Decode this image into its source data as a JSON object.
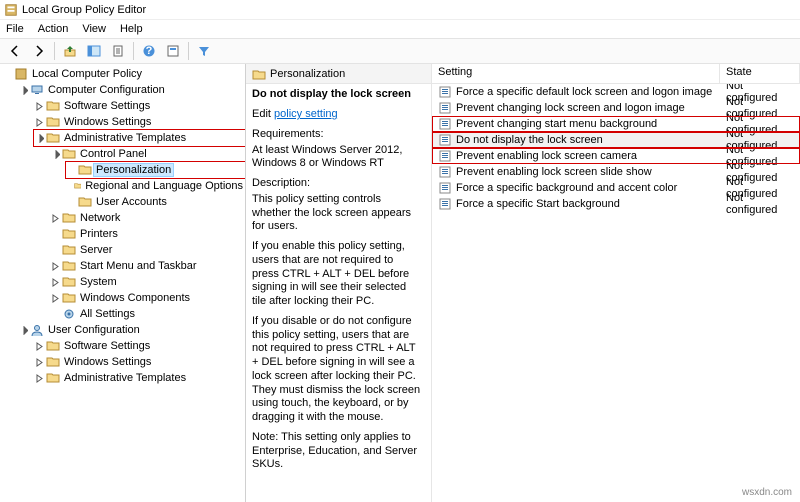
{
  "window": {
    "title": "Local Group Policy Editor"
  },
  "menu": {
    "file": "File",
    "action": "Action",
    "view": "View",
    "help": "Help"
  },
  "tree": {
    "root": "Local Computer Policy",
    "cc": "Computer Configuration",
    "ss": "Software Settings",
    "ws": "Windows Settings",
    "at": "Administrative Templates",
    "cp": "Control Panel",
    "pers": "Personalization",
    "rlo": "Regional and Language Options",
    "ua": "User Accounts",
    "net": "Network",
    "prn": "Printers",
    "srv": "Server",
    "smt": "Start Menu and Taskbar",
    "sys": "System",
    "wcomp": "Windows Components",
    "alls": "All Settings",
    "uc": "User Configuration",
    "uss": "Software Settings",
    "uws": "Windows Settings",
    "uat": "Administrative Templates"
  },
  "desc": {
    "crumb": "Personalization",
    "title": "Do not display the lock screen",
    "edit": "Edit",
    "policy_link": "policy setting",
    "req_label": "Requirements:",
    "req_text": "At least Windows Server 2012, Windows 8 or Windows RT",
    "desc_label": "Description:",
    "d1": "This policy setting controls whether the lock screen appears for users.",
    "d2": "If you enable this policy setting, users that are not required to press CTRL + ALT + DEL before signing in will see their selected tile after locking their PC.",
    "d3": "If you disable or do not configure this policy setting, users that are not required to press CTRL + ALT + DEL before signing in will see a lock screen after locking their PC. They must dismiss the lock screen using touch, the keyboard, or by dragging it with the mouse.",
    "d4": "Note: This setting only applies to Enterprise, Education, and Server SKUs."
  },
  "list": {
    "col_setting": "Setting",
    "col_state": "State",
    "items": [
      {
        "name": "Force a specific default lock screen and logon image",
        "state": "Not configured",
        "hl": false,
        "sel": false
      },
      {
        "name": "Prevent changing lock screen and logon image",
        "state": "Not configured",
        "hl": false,
        "sel": false
      },
      {
        "name": "Prevent changing start menu background",
        "state": "Not configured",
        "hl": true,
        "sel": false
      },
      {
        "name": "Do not display the lock screen",
        "state": "Not configured",
        "hl": true,
        "sel": true
      },
      {
        "name": "Prevent enabling lock screen camera",
        "state": "Not configured",
        "hl": true,
        "sel": false
      },
      {
        "name": "Prevent enabling lock screen slide show",
        "state": "Not configured",
        "hl": false,
        "sel": false
      },
      {
        "name": "Force a specific background and accent color",
        "state": "Not configured",
        "hl": false,
        "sel": false
      },
      {
        "name": "Force a specific Start background",
        "state": "Not configured",
        "hl": false,
        "sel": false
      }
    ]
  },
  "watermark": "wsxdn.com"
}
